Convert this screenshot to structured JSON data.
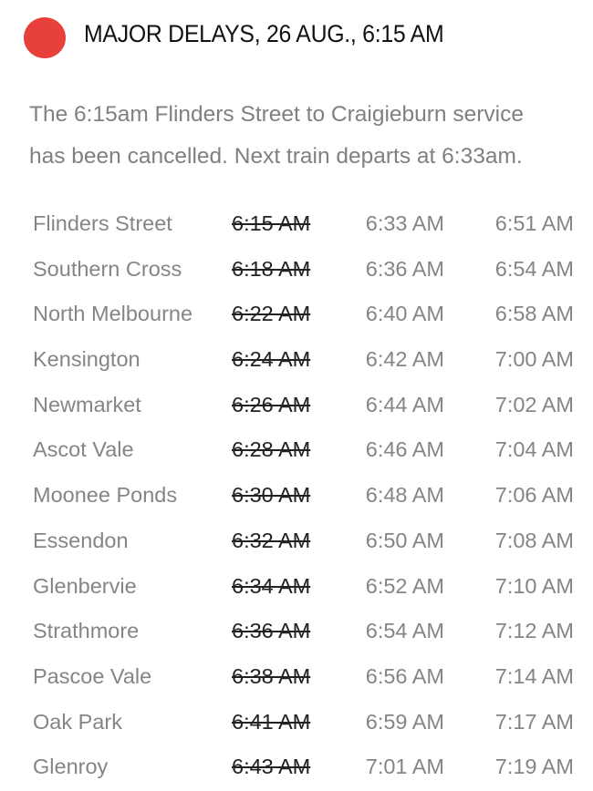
{
  "alert": {
    "status_color": "#e8403a",
    "title": "MAJOR DELAYS, 26 AUG., 6:15 AM",
    "message_line1": "The 6:15am Flinders Street to Craigieburn service",
    "message_line2": "has been cancelled. Next train departs at 6:33am."
  },
  "timetable": [
    {
      "station": "Flinders Street",
      "cancelled": "6:15 AM",
      "next": "6:33 AM",
      "after": "6:51 AM"
    },
    {
      "station": "Southern Cross",
      "cancelled": "6:18 AM",
      "next": "6:36 AM",
      "after": "6:54 AM"
    },
    {
      "station": "North Melbourne",
      "cancelled": "6:22 AM",
      "next": "6:40 AM",
      "after": "6:58 AM"
    },
    {
      "station": "Kensington",
      "cancelled": "6:24 AM",
      "next": "6:42 AM",
      "after": "7:00 AM"
    },
    {
      "station": "Newmarket",
      "cancelled": "6:26 AM",
      "next": "6:44 AM",
      "after": "7:02 AM"
    },
    {
      "station": "Ascot Vale",
      "cancelled": "6:28 AM",
      "next": "6:46 AM",
      "after": "7:04 AM"
    },
    {
      "station": "Moonee Ponds",
      "cancelled": "6:30 AM",
      "next": "6:48 AM",
      "after": "7:06 AM"
    },
    {
      "station": "Essendon",
      "cancelled": "6:32 AM",
      "next": "6:50 AM",
      "after": "7:08 AM"
    },
    {
      "station": "Glenbervie",
      "cancelled": "6:34 AM",
      "next": "6:52 AM",
      "after": "7:10 AM"
    },
    {
      "station": "Strathmore",
      "cancelled": "6:36 AM",
      "next": "6:54 AM",
      "after": "7:12 AM"
    },
    {
      "station": "Pascoe Vale",
      "cancelled": "6:38 AM",
      "next": "6:56 AM",
      "after": "7:14 AM"
    },
    {
      "station": "Oak Park",
      "cancelled": "6:41 AM",
      "next": "6:59 AM",
      "after": "7:17 AM"
    },
    {
      "station": "Glenroy",
      "cancelled": "6:43 AM",
      "next": "7:01 AM",
      "after": "7:19 AM"
    }
  ]
}
